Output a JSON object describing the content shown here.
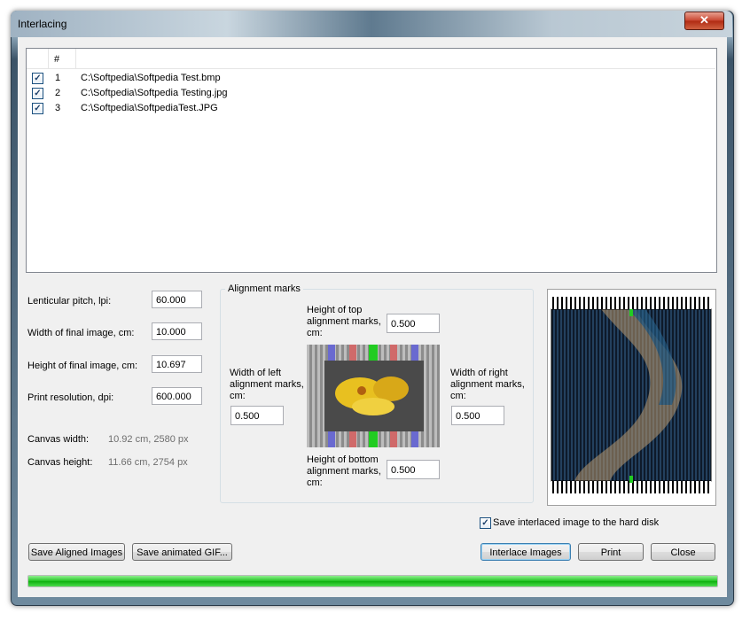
{
  "window": {
    "title": "Interlacing",
    "close_glyph": "✕"
  },
  "list": {
    "columns": [
      "",
      "#",
      ""
    ],
    "rows": [
      {
        "checked": true,
        "num": "1",
        "path": "C:\\Softpedia\\Softpedia Test.bmp"
      },
      {
        "checked": true,
        "num": "2",
        "path": "C:\\Softpedia\\Softpedia Testing.jpg"
      },
      {
        "checked": true,
        "num": "3",
        "path": "C:\\Softpedia\\SoftpediaTest.JPG"
      }
    ]
  },
  "settings": {
    "pitch_label": "Lenticular pitch, lpi:",
    "pitch_value": "60.000",
    "width_label": "Width of final image, cm:",
    "width_value": "10.000",
    "height_label": "Height of final image, cm:",
    "height_value": "10.697",
    "res_label": "Print resolution, dpi:",
    "res_value": "600.000",
    "canvas_width_label": "Canvas width:",
    "canvas_width_value": "10.92 cm, 2580 px",
    "canvas_height_label": "Canvas height:",
    "canvas_height_value": "11.66 cm, 2754 px"
  },
  "alignment": {
    "title": "Alignment marks",
    "top_label_1": "Height of top",
    "top_label_2": "alignment marks,",
    "top_label_3": "cm:",
    "top_value": "0.500",
    "left_label_1": "Width of left",
    "left_label_2": "alignment marks,",
    "left_label_3": "cm:",
    "left_value": "0.500",
    "right_label_1": "Width of right",
    "right_label_2": "alignment marks,",
    "right_label_3": "cm:",
    "right_value": "0.500",
    "bottom_label_1": "Height of bottom",
    "bottom_label_2": "alignment marks,",
    "bottom_label_3": "cm:",
    "bottom_value": "0.500"
  },
  "save_checkbox": {
    "label": "Save interlaced image to the hard disk",
    "checked": true
  },
  "buttons": {
    "save_aligned": "Save Aligned Images",
    "save_gif": "Save animated GIF...",
    "interlace": "Interlace Images",
    "print": "Print",
    "close": "Close"
  },
  "progress": {
    "fraction": 1.0
  },
  "colors": {
    "progress": "#22c422",
    "accent": "#3c7fb1"
  }
}
